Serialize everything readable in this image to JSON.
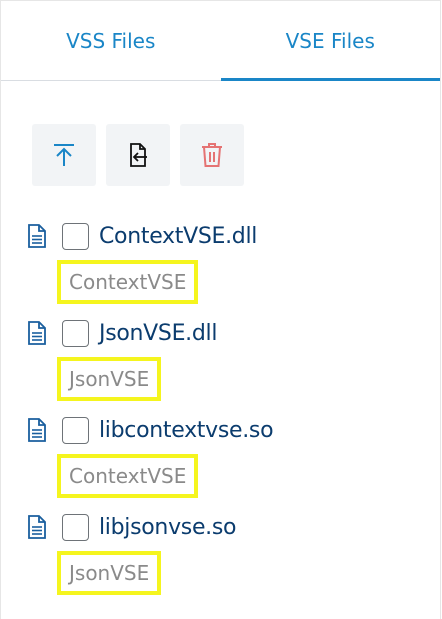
{
  "tabs": [
    {
      "label": "VSS Files",
      "active": false
    },
    {
      "label": "VSE Files",
      "active": true
    }
  ],
  "toolbar": {
    "upload_icon": "upload-icon",
    "import_icon": "file-import-icon",
    "delete_icon": "trash-icon"
  },
  "files": [
    {
      "name": "ContextVSE.dll",
      "alias": "ContextVSE",
      "checked": false
    },
    {
      "name": "JsonVSE.dll",
      "alias": "JsonVSE",
      "checked": false
    },
    {
      "name": "libcontextvse.so",
      "alias": "ContextVSE",
      "checked": false
    },
    {
      "name": "libjsonvse.so",
      "alias": "JsonVSE",
      "checked": false
    }
  ],
  "colors": {
    "accent": "#1a86c7",
    "text": "#0b3c6e",
    "highlight": "#f5f51e",
    "delete": "#e57373"
  }
}
